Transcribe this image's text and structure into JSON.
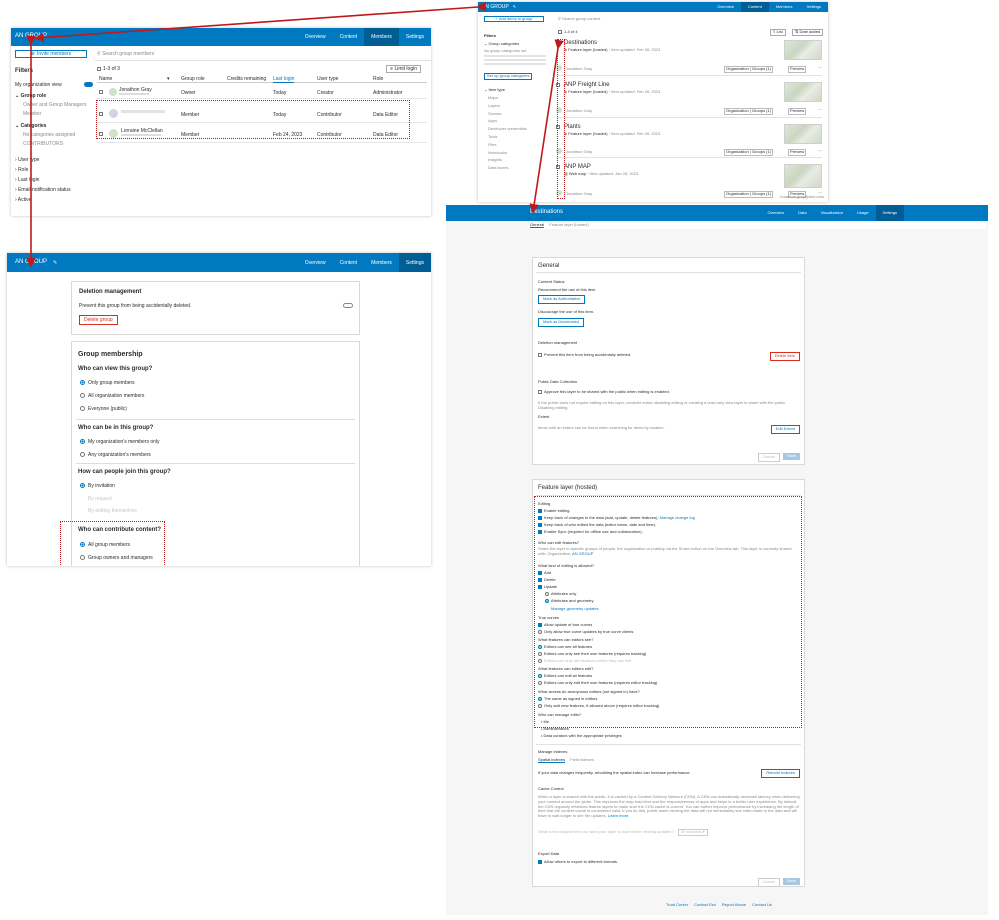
{
  "colors": {
    "brand_blue": "#0079c1",
    "brand_blue_dark": "#005e95",
    "danger": "#d83020",
    "highlight": "#c0191b"
  },
  "members_panel": {
    "group_title": "AN GROUP",
    "nav": [
      "Overview",
      "Content",
      "Members",
      "Settings"
    ],
    "invite_button": "Invite members",
    "search_placeholder": "Search group members",
    "filters_title": "Filters",
    "org_view": "My organization view",
    "group_role": "Group role",
    "role_option": "Owner and Group Managers",
    "role_member": "Member",
    "categories": "Categories",
    "categories_none": "No categories assigned",
    "categories_sub": "CONTRIBUTORS",
    "filter_more": [
      "User type",
      "Role",
      "Last login",
      "Email notification status",
      "Active"
    ],
    "count": "1-3 of 3",
    "list_layout": "Limit login",
    "columns": [
      "Name",
      "Group role",
      "Credits remaining",
      "Last login",
      "User type",
      "Role"
    ],
    "rows": [
      {
        "name": "Jonathon Gray",
        "role": "Owner",
        "credits": "",
        "last_login": "Today",
        "user_type": "Creator",
        "org_role": "Administrator"
      },
      {
        "name": "",
        "role": "Member",
        "credits": "",
        "last_login": "Today",
        "user_type": "Contributor",
        "org_role": "Data Editor"
      },
      {
        "name": "Lorraine McClellan",
        "role": "Member",
        "credits": "",
        "last_login": "Feb 24, 2023",
        "user_type": "Contributor",
        "org_role": "Data Editor"
      }
    ]
  },
  "content_panel": {
    "group_title": "AN GROUP",
    "nav": [
      "Overview",
      "Content",
      "Members",
      "Settings"
    ],
    "add_button": "+ Add items to group",
    "search_placeholder": "Search group content",
    "count": "1-4 of 4",
    "list_label": "List",
    "date_label": "Date added",
    "filters_title": "Filters",
    "group_categories": "Group categories",
    "group_categories_note": "No group categories set",
    "set_categories": "Set up group categories",
    "item_types": "Item type",
    "types": [
      "Maps",
      "Layers",
      "Scenes",
      "Apps",
      "Developer credentials",
      "Tools",
      "Files",
      "Notebooks",
      "Insights",
      "Data stores"
    ],
    "items": [
      {
        "title": "Destinations",
        "type": "Feature layer (hosted)",
        "updated": "Item updated: Feb 28, 2023",
        "owner": "Jonathon Gray",
        "share": "Organization",
        "groups": "Groups (1)",
        "view": "Preview"
      },
      {
        "title": "ANP Freight Line",
        "type": "Feature layer (hosted)",
        "updated": "Item updated: Feb 28, 2023",
        "owner": "Jonathon Gray",
        "share": "Organization",
        "groups": "Groups (1)",
        "view": "Preview"
      },
      {
        "title": "Plants",
        "type": "Feature layer (hosted)",
        "updated": "Item updated: Feb 28, 2023",
        "owner": "Jonathon Gray",
        "share": "Organization",
        "groups": "Groups (1)",
        "view": "Preview"
      },
      {
        "title": "ANP MAP",
        "type": "Web map",
        "updated": "Item updated: Jan 28, 2023",
        "owner": "Jonathon Gray",
        "share": "Organization",
        "groups": "Groups (1)",
        "view": "Preview"
      }
    ],
    "footer_user": "Jonathon.gray@esri.com"
  },
  "settings_panel": {
    "group_title": "AN GROUP",
    "nav": [
      "Overview",
      "Content",
      "Members",
      "Settings"
    ],
    "deletion_title": "Deletion management",
    "deletion_text": "Prevent this group from being accidentally deleted.",
    "delete_button": "Delete group",
    "membership_title": "Group membership",
    "view_q": "Who can view this group?",
    "view_opts": [
      "Only group members",
      "All organization members",
      "Everyone (public)"
    ],
    "in_q": "Who can be in this group?",
    "in_opts": [
      "My organization's members only",
      "Any organization's members"
    ],
    "join_q": "How can people join this group?",
    "join_opts": [
      "By invitation",
      "By request",
      "By adding themselves"
    ],
    "contribute_q": "Who can contribute content?",
    "contribute_opts": [
      "All group members",
      "Group owners and managers"
    ]
  },
  "item_panel": {
    "title": "Destinations",
    "nav": [
      "Overview",
      "Data",
      "Visualization",
      "Usage",
      "Settings"
    ],
    "subtabs": [
      "General",
      "Feature layer (hosted)"
    ],
    "general_title": "General",
    "content_status": "Content Status",
    "recommend": "Recommend the use of this item.",
    "authoritative": "Mark as Authoritative",
    "discourage": "Discourage the use of this item.",
    "deprecated": "Mark as Deprecated",
    "deletion": "Deletion management",
    "deletion_cb": "Prevent this item from being accidentally deleted.",
    "delete_item": "Delete item",
    "public_title": "Public Data Collection",
    "public_cb": "Approve this layer to be shared with the public when editing is enabled.",
    "public_note": "If the public does not require editing on this layer, consider editor, disabling editing or creating a read-only view layer to share with the public. Disabling editing.",
    "extent_title": "Extent",
    "extent_text": "Items with an extent can be found when searching for items by location.",
    "edit_extent": "Edit Extent",
    "cancel": "Cancel",
    "save": "Save",
    "fl_title": "Feature layer (hosted)",
    "editing": "Editing",
    "edit_cbs": [
      "Enable editing.",
      "Keep track of changes to the data (add, update, delete features).",
      "Keep track of who edited the data (editor name, date and time).",
      "Enable Sync (required for offline use and collaboration)."
    ],
    "manage_tracking": "Manage change log",
    "who_edit_q": "Who can edit features?",
    "who_edit_text": "Share the layer to specific groups of people, the organization or publicly via the Share button on the Overview tab. This layer is currently shared with: Organization,",
    "shared_group": "AN GROUP",
    "kind_q": "What kind of editing is allowed?",
    "kind_cbs": [
      "Add",
      "Delete",
      "Update"
    ],
    "kind_radios": [
      "Attributes only",
      "Attributes and geometry"
    ],
    "manage_geometry": "Manage geometry updates",
    "true_curves": "True curves",
    "curves_cb": "Allow update of true curves",
    "curves_radio": "Only allow true curve updates by true curve clients",
    "see_q": "What features can editors see?",
    "see_opts": [
      "Editors can see all features",
      "Editors can only see their own features (requires tracking)",
      "Editors can only see features where they can edit"
    ],
    "edit_q": "What features can editors edit?",
    "edit_opts": [
      "Editors can edit all features",
      "Editors can only edit their own features (requires editor tracking)"
    ],
    "anon_q": "What access do anonymous editors (not signed in) have?",
    "anon_opts": [
      "The same as signed in editors",
      "Only add new features, if allowed above (requires editor tracking)"
    ],
    "manage_q": "Who can manage edits?",
    "manage_list": [
      "Me",
      "Administrators",
      "Data curators with the appropriate privileges"
    ],
    "indexes_title": "Manage indexes",
    "indexes_tabs": [
      "Spatial indexes",
      "Field indexes"
    ],
    "indexes_text": "If your data changes frequently, rebuilding the spatial index can increase performance.",
    "rebuild": "Rebuild Indexes",
    "cache_title": "Cache Control",
    "cache_text": "When a layer is shared with the public, it is cached by a Content Delivery Network (CDN). A CDN can dramatically decrease latency when delivering your content around the globe. This improves the map load time and the responsiveness of apps and helps to a better user experience. By default, the CDN regularly refreshes feature layers to make sure the CDN cache is current. You can further improve performance by increasing the length of time that the content cache is considered valid. If you do this, public users viewing the data will not immediately see edits made to the data and will have to wait longer to see the updates.",
    "learn_more": "Learn more.",
    "cache_q": "What is the longest time you want your layer to wait before viewing updates?",
    "cache_val": "30 seconds",
    "export_title": "Export Data",
    "export_cb": "Allow others to export to different formats.",
    "footer_links": [
      "Trust Center",
      "Contact Esri",
      "Report Abuse",
      "Contact Us"
    ]
  }
}
